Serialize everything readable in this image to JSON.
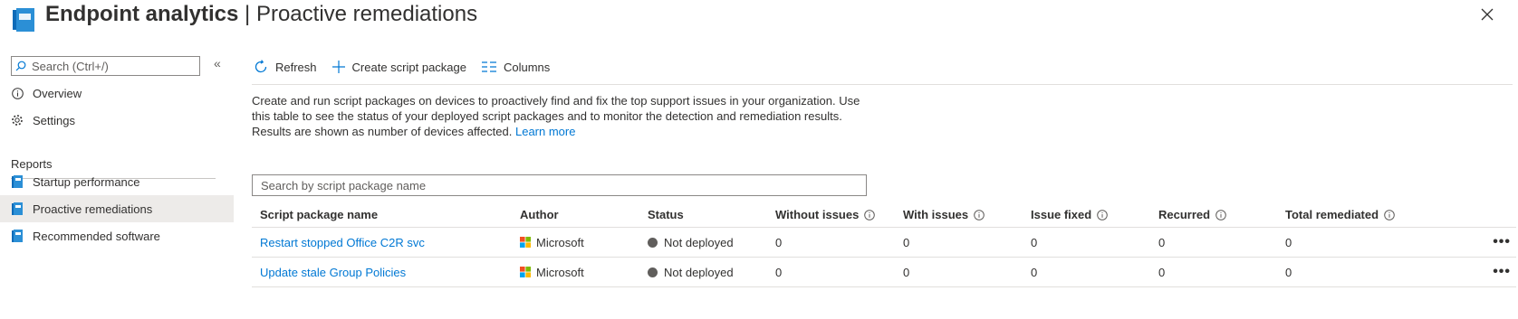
{
  "header": {
    "title_main": "Endpoint analytics",
    "title_sep": " | ",
    "title_sub": "Proactive remediations",
    "close_icon": "close-icon"
  },
  "sidebar": {
    "search_placeholder": "Search (Ctrl+/)",
    "collapse_icon": "double-chevron-left-icon",
    "items": [
      {
        "label": "Overview",
        "icon": "info-icon"
      },
      {
        "label": "Settings",
        "icon": "gear-icon"
      }
    ],
    "section_title": "Reports",
    "report_items": [
      {
        "label": "Startup performance",
        "icon": "book-icon",
        "selected": false
      },
      {
        "label": "Proactive remediations",
        "icon": "book-icon",
        "selected": true
      },
      {
        "label": "Recommended software",
        "icon": "book-icon",
        "selected": false
      }
    ]
  },
  "toolbar": {
    "refresh": "Refresh",
    "create": "Create script package",
    "columns": "Columns"
  },
  "description": {
    "text": "Create and run script packages on devices to proactively find and fix the top support issues in your organization. Use this table to see the status of your deployed script packages and to monitor the detection and remediation results. Results are shown as number of devices affected. ",
    "learn_more": "Learn more"
  },
  "table": {
    "search_placeholder": "Search by script package name",
    "columns": [
      "Script package name",
      "Author",
      "Status",
      "Without issues",
      "With issues",
      "Issue fixed",
      "Recurred",
      "Total remediated"
    ],
    "rows": [
      {
        "name": "Restart stopped Office C2R svc",
        "author": "Microsoft",
        "status": "Not deployed",
        "without_issues": "0",
        "with_issues": "0",
        "issue_fixed": "0",
        "recurred": "0",
        "total_remediated": "0"
      },
      {
        "name": "Update stale Group Policies",
        "author": "Microsoft",
        "status": "Not deployed",
        "without_issues": "0",
        "with_issues": "0",
        "issue_fixed": "0",
        "recurred": "0",
        "total_remediated": "0"
      }
    ],
    "more_label": "•••"
  },
  "colors": {
    "accent": "#0078d4",
    "status_not_deployed": "#605e5c",
    "ms_red": "#f25022",
    "ms_green": "#7fba00",
    "ms_blue": "#00a4ef",
    "ms_yellow": "#ffb900"
  }
}
